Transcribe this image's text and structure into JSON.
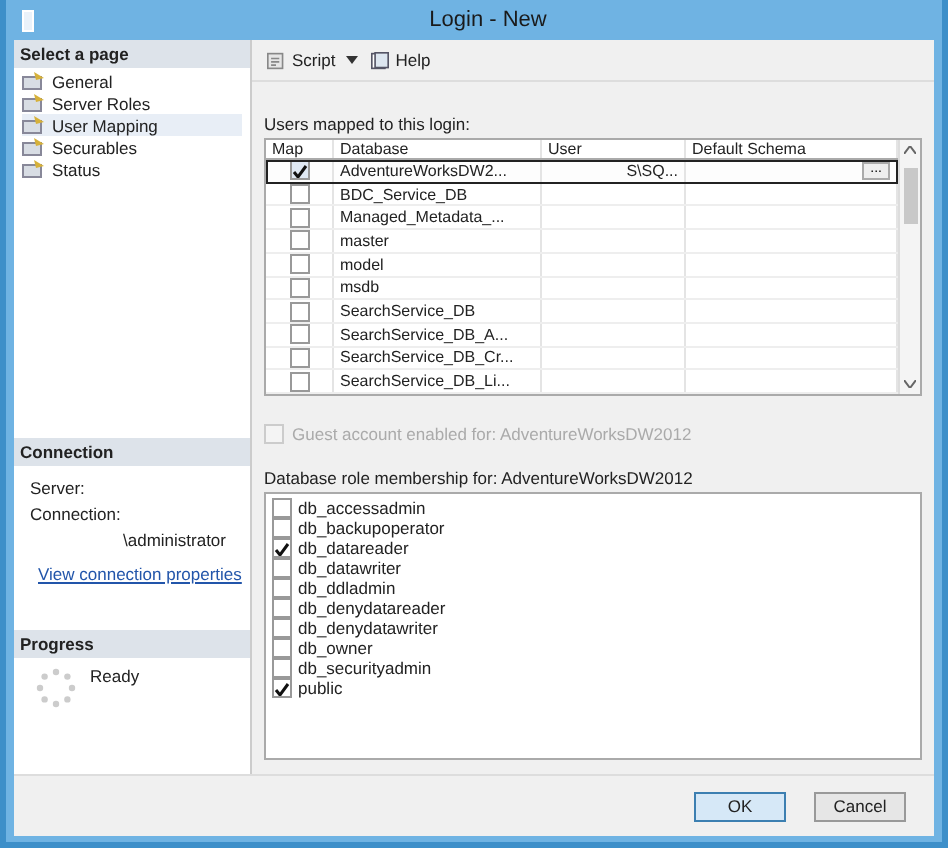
{
  "window": {
    "title": "Login - New"
  },
  "sidebar": {
    "header": "Select a page",
    "items": [
      {
        "label": "General",
        "selected": false
      },
      {
        "label": "Server Roles",
        "selected": false
      },
      {
        "label": "User Mapping",
        "selected": true
      },
      {
        "label": "Securables",
        "selected": false
      },
      {
        "label": "Status",
        "selected": false
      }
    ]
  },
  "connection": {
    "header": "Connection",
    "server_label": "Server:",
    "connection_label": "Connection:",
    "connection_value": "\\administrator",
    "link": "View connection properties"
  },
  "progress": {
    "header": "Progress",
    "status": "Ready"
  },
  "toolbar": {
    "script": "Script",
    "help": "Help"
  },
  "mapping": {
    "label": "Users mapped to this login:",
    "columns": [
      "Map",
      "Database",
      "User",
      "Default Schema"
    ],
    "rows": [
      {
        "map": true,
        "database": "AdventureWorksDW2...",
        "user": "S\\SQ...",
        "schema_button": "...",
        "selected": true
      },
      {
        "map": false,
        "database": "BDC_Service_DB",
        "selected": false
      },
      {
        "map": false,
        "database": "Managed_Metadata_...",
        "selected": false
      },
      {
        "map": false,
        "database": "master",
        "selected": false
      },
      {
        "map": false,
        "database": "model",
        "selected": false
      },
      {
        "map": false,
        "database": "msdb",
        "selected": false
      },
      {
        "map": false,
        "database": "SearchService_DB",
        "selected": false
      },
      {
        "map": false,
        "database": "SearchService_DB_A...",
        "selected": false
      },
      {
        "map": false,
        "database": "SearchService_DB_Cr...",
        "selected": false
      },
      {
        "map": false,
        "database": "SearchService_DB_Li...",
        "selected": false
      }
    ]
  },
  "guest": {
    "label": "Guest account enabled for: AdventureWorksDW2012",
    "checked": false,
    "disabled": true
  },
  "roles": {
    "label": "Database role membership for: AdventureWorksDW2012",
    "items": [
      {
        "name": "db_accessadmin",
        "checked": false
      },
      {
        "name": "db_backupoperator",
        "checked": false
      },
      {
        "name": "db_datareader",
        "checked": true
      },
      {
        "name": "db_datawriter",
        "checked": false
      },
      {
        "name": "db_ddladmin",
        "checked": false
      },
      {
        "name": "db_denydatareader",
        "checked": false
      },
      {
        "name": "db_denydatawriter",
        "checked": false
      },
      {
        "name": "db_owner",
        "checked": false
      },
      {
        "name": "db_securityadmin",
        "checked": false
      },
      {
        "name": "public",
        "checked": true
      }
    ]
  },
  "buttons": [
    {
      "label": "OK",
      "selected": true
    },
    {
      "label": "Cancel",
      "selected": false
    }
  ]
}
